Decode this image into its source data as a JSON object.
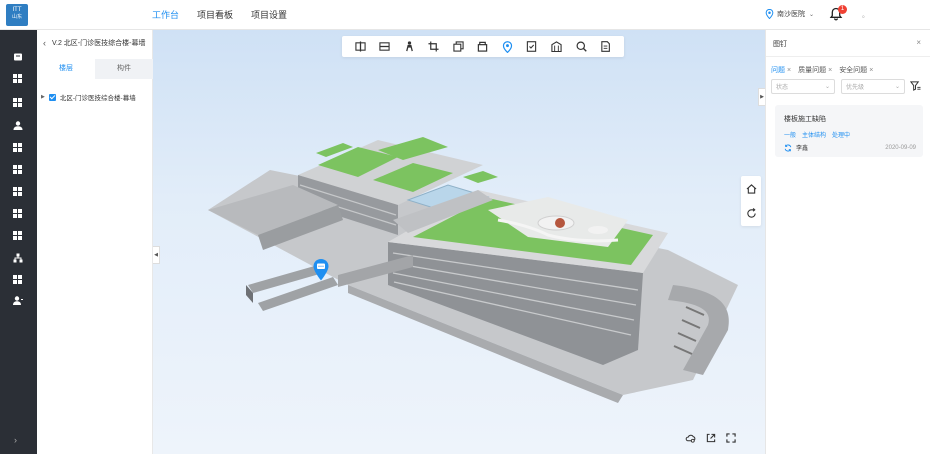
{
  "header": {
    "logo_line1": "ITT",
    "logo_line2": "山东",
    "nav": [
      {
        "label": "工作台",
        "active": true
      },
      {
        "label": "项目看板",
        "active": false
      },
      {
        "label": "项目设置",
        "active": false
      }
    ],
    "location": "南沙医院",
    "notification_count": "1",
    "user": "。"
  },
  "rail": {
    "icons": [
      "workbench-icon",
      "grid-icon",
      "grid-icon",
      "users-icon",
      "grid-icon",
      "grid-icon",
      "grid-icon",
      "grid-icon",
      "grid-icon",
      "network-icon",
      "grid-icon",
      "person-icon"
    ],
    "expand": "›"
  },
  "left_panel": {
    "title": "V.2 北区-门诊医技综合楼-幕墙",
    "tabs": [
      {
        "label": "楼层",
        "active": true
      },
      {
        "label": "构件",
        "active": false
      }
    ],
    "tree": [
      {
        "label": "北区-门诊医技综合楼-幕墙",
        "checked": true
      }
    ]
  },
  "viewport": {
    "toolbar_icons": [
      "section-icon",
      "layer-icon",
      "person-walk-icon",
      "crop-icon",
      "copy-icon",
      "box-icon",
      "location-pin-icon",
      "checklist-icon",
      "building-icon",
      "search-icon",
      "document-icon"
    ],
    "marker_icon": "comment-icon",
    "side_controls": [
      "home-icon",
      "refresh-icon"
    ],
    "bottom_controls": [
      "cloud-settings-icon",
      "export-icon",
      "fullscreen-icon"
    ]
  },
  "right_panel": {
    "title": "图钉",
    "filter_chips": [
      {
        "label": "问题",
        "active": true
      },
      {
        "label": "质量问题",
        "active": false
      },
      {
        "label": "安全问题",
        "active": false
      }
    ],
    "status_placeholder": "状态",
    "priority_placeholder": "优先级",
    "issue": {
      "title": "楼板施工缺陷",
      "tags": [
        "一般",
        "主体结构",
        "处理中"
      ],
      "user": "李鑫",
      "date": "2020-09-09"
    }
  },
  "colors": {
    "accent": "#1f8ff1",
    "rail_bg": "#2b2f36",
    "roof_green": "#7cc360"
  }
}
